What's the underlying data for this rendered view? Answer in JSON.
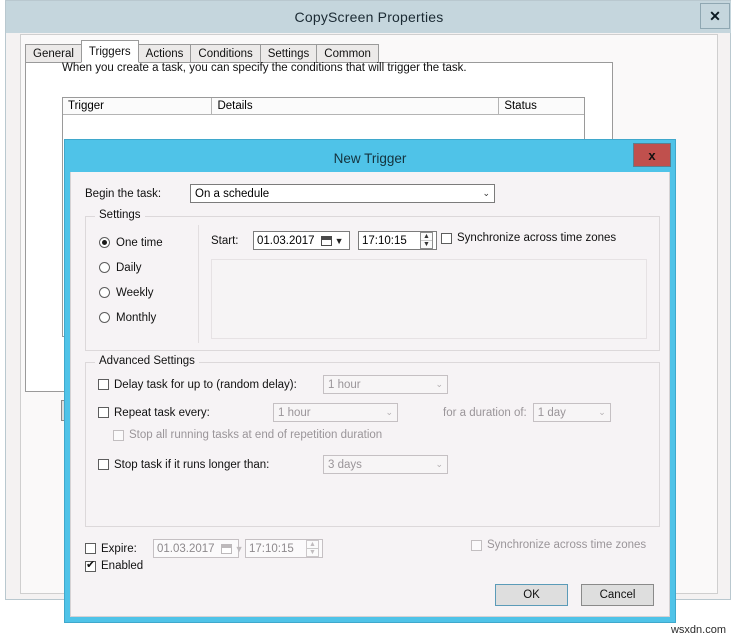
{
  "background_window": {
    "title": "CopyScreen Properties",
    "close_label": "✕",
    "tabs": [
      {
        "label": "General",
        "active": false
      },
      {
        "label": "Triggers",
        "active": true
      },
      {
        "label": "Actions",
        "active": false
      },
      {
        "label": "Conditions",
        "active": false
      },
      {
        "label": "Settings",
        "active": false
      },
      {
        "label": "Common",
        "active": false
      }
    ],
    "description": "When you create a task, you can specify the conditions that will trigger the task.",
    "table": {
      "columns": [
        "Trigger",
        "Details",
        "Status"
      ],
      "rows": []
    }
  },
  "dialog": {
    "title": "New Trigger",
    "close_label": "x",
    "begin_task": {
      "label": "Begin the task:",
      "value": "On a schedule",
      "arrow": "⌄"
    },
    "settings": {
      "title": "Settings",
      "radios": [
        {
          "label": "One time",
          "selected": true
        },
        {
          "label": "Daily",
          "selected": false
        },
        {
          "label": "Weekly",
          "selected": false
        },
        {
          "label": "Monthly",
          "selected": false
        }
      ],
      "start_label": "Start:",
      "start_date": "01.03.2017",
      "start_time": "17:10:15",
      "sync_label": "Synchronize across time zones",
      "sync_checked": false
    },
    "advanced": {
      "title": "Advanced Settings",
      "delay": {
        "label": "Delay task for up to (random delay):",
        "checked": false,
        "value": "1 hour"
      },
      "repeat": {
        "label": "Repeat task every:",
        "checked": false,
        "value": "1 hour",
        "duration_label": "for a duration of:",
        "duration_value": "1 day"
      },
      "stop_all": {
        "label": "Stop all running tasks at end of repetition duration",
        "checked": false
      },
      "stop_longer": {
        "label": "Stop task if it runs longer than:",
        "checked": false,
        "value": "3 days"
      }
    },
    "expire": {
      "label": "Expire:",
      "checked": false,
      "date": "01.03.2017",
      "time": "17:10:15",
      "sync_label": "Synchronize across time zones",
      "sync_checked": false
    },
    "enabled": {
      "label": "Enabled",
      "checked": true
    },
    "buttons": {
      "ok": "OK",
      "cancel": "Cancel"
    }
  },
  "watermark": "wsxdn.com",
  "colors": {
    "dialog_frame": "#4fc3e8",
    "close_red": "#c0504d",
    "bg_titlebar": "#c5d6dd"
  }
}
